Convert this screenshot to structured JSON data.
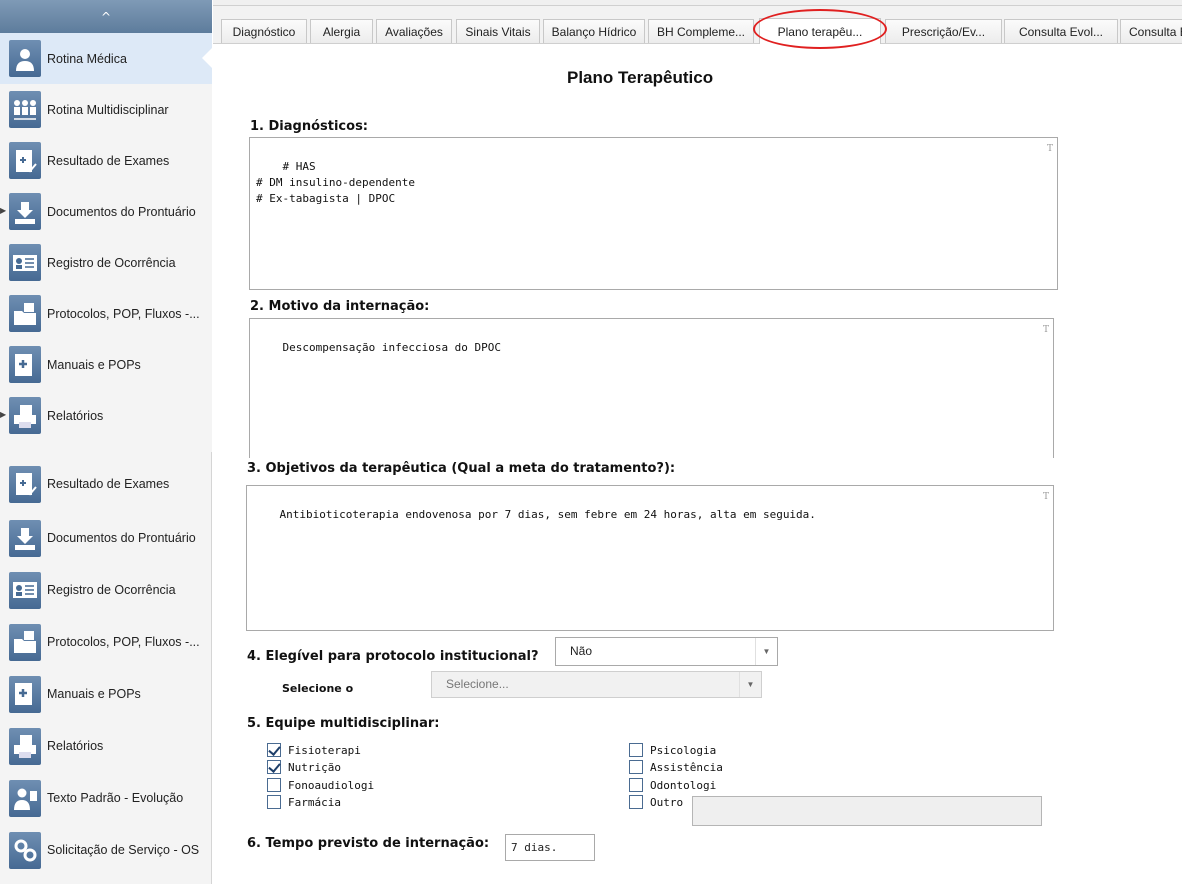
{
  "sidebar": {
    "collapse_glyph": "^",
    "top_items": [
      {
        "label": "Rotina Médica",
        "icon": "doctor-icon",
        "active": true
      },
      {
        "label": "Rotina Multidisciplinar",
        "icon": "team-icon"
      },
      {
        "label": "Resultado de Exames",
        "icon": "exam-result-icon"
      },
      {
        "label": "Documentos do Prontuário",
        "icon": "document-download-icon",
        "caret": true
      },
      {
        "label": "Registro de Ocorrência",
        "icon": "id-card-icon"
      },
      {
        "label": "Protocolos, POP, Fluxos -...",
        "icon": "folder-icon"
      },
      {
        "label": "Manuais e POPs",
        "icon": "manual-icon"
      },
      {
        "label": "Relatórios",
        "icon": "printer-icon",
        "caret": true
      }
    ],
    "bottom_items": [
      {
        "label": "Resultado de Exames",
        "icon": "exam-result-icon"
      },
      {
        "label": "Documentos do Prontuário",
        "icon": "document-download-icon"
      },
      {
        "label": "Registro de Ocorrência",
        "icon": "id-card-icon"
      },
      {
        "label": "Protocolos, POP, Fluxos -...",
        "icon": "folder-icon"
      },
      {
        "label": "Manuais e POPs",
        "icon": "manual-icon"
      },
      {
        "label": "Relatórios",
        "icon": "printer-icon"
      },
      {
        "label": "Texto Padrão - Evolução",
        "icon": "doctor-text-icon"
      },
      {
        "label": "Solicitação de Serviço - OS",
        "icon": "gears-icon"
      }
    ]
  },
  "tabs": [
    {
      "label": "Diagnóstico"
    },
    {
      "label": "Alergia"
    },
    {
      "label": "Avaliações"
    },
    {
      "label": "Sinais Vitais"
    },
    {
      "label": "Balanço Hídrico"
    },
    {
      "label": "BH Compleme..."
    },
    {
      "label": "Plano terapêu...",
      "active": true
    },
    {
      "label": "Prescrição/Ev..."
    },
    {
      "label": "Consulta Evol..."
    },
    {
      "label": "Consulta Ev"
    }
  ],
  "form": {
    "title": "Plano Terapêutico",
    "q1": {
      "label": "1. Diagnósticos:",
      "value": "# HAS\n# DM insulino-dependente\n# Ex-tabagista | DPOC"
    },
    "q2": {
      "label": "2. Motivo da internação:",
      "value": "Descompensação infecciosa do DPOC"
    },
    "q3": {
      "label": "3. Objetivos da terapêutica (Qual a meta do tratamento?):",
      "value": "Antibioticoterapia endovenosa por 7 dias, sem febre em 24 horas, alta em seguida."
    },
    "q4": {
      "label": "4. Elegível para protocolo institucional?",
      "value": "Não",
      "select_label": "Selecione o",
      "select_placeholder": "Selecione..."
    },
    "q5": {
      "label": "5. Equipe multidisciplinar:",
      "left": [
        {
          "label": "Fisioterapi",
          "checked": true
        },
        {
          "label": "Nutrição",
          "checked": true
        },
        {
          "label": "Fonoaudiologi",
          "checked": false
        },
        {
          "label": "Farmácia",
          "checked": false
        }
      ],
      "right": [
        {
          "label": "Psicologia",
          "checked": false
        },
        {
          "label": "Assistência",
          "checked": false
        },
        {
          "label": "Odontologi",
          "checked": false
        },
        {
          "label": "Outro",
          "checked": false
        }
      ]
    },
    "q6": {
      "label": "6. Tempo previsto de internação:",
      "value": "7 dias."
    },
    "textbox_marker": "T"
  },
  "colors": {
    "sidebar_active": "#dde9f7",
    "icon_blue": "#466a93",
    "annotation_red": "#e02020"
  }
}
